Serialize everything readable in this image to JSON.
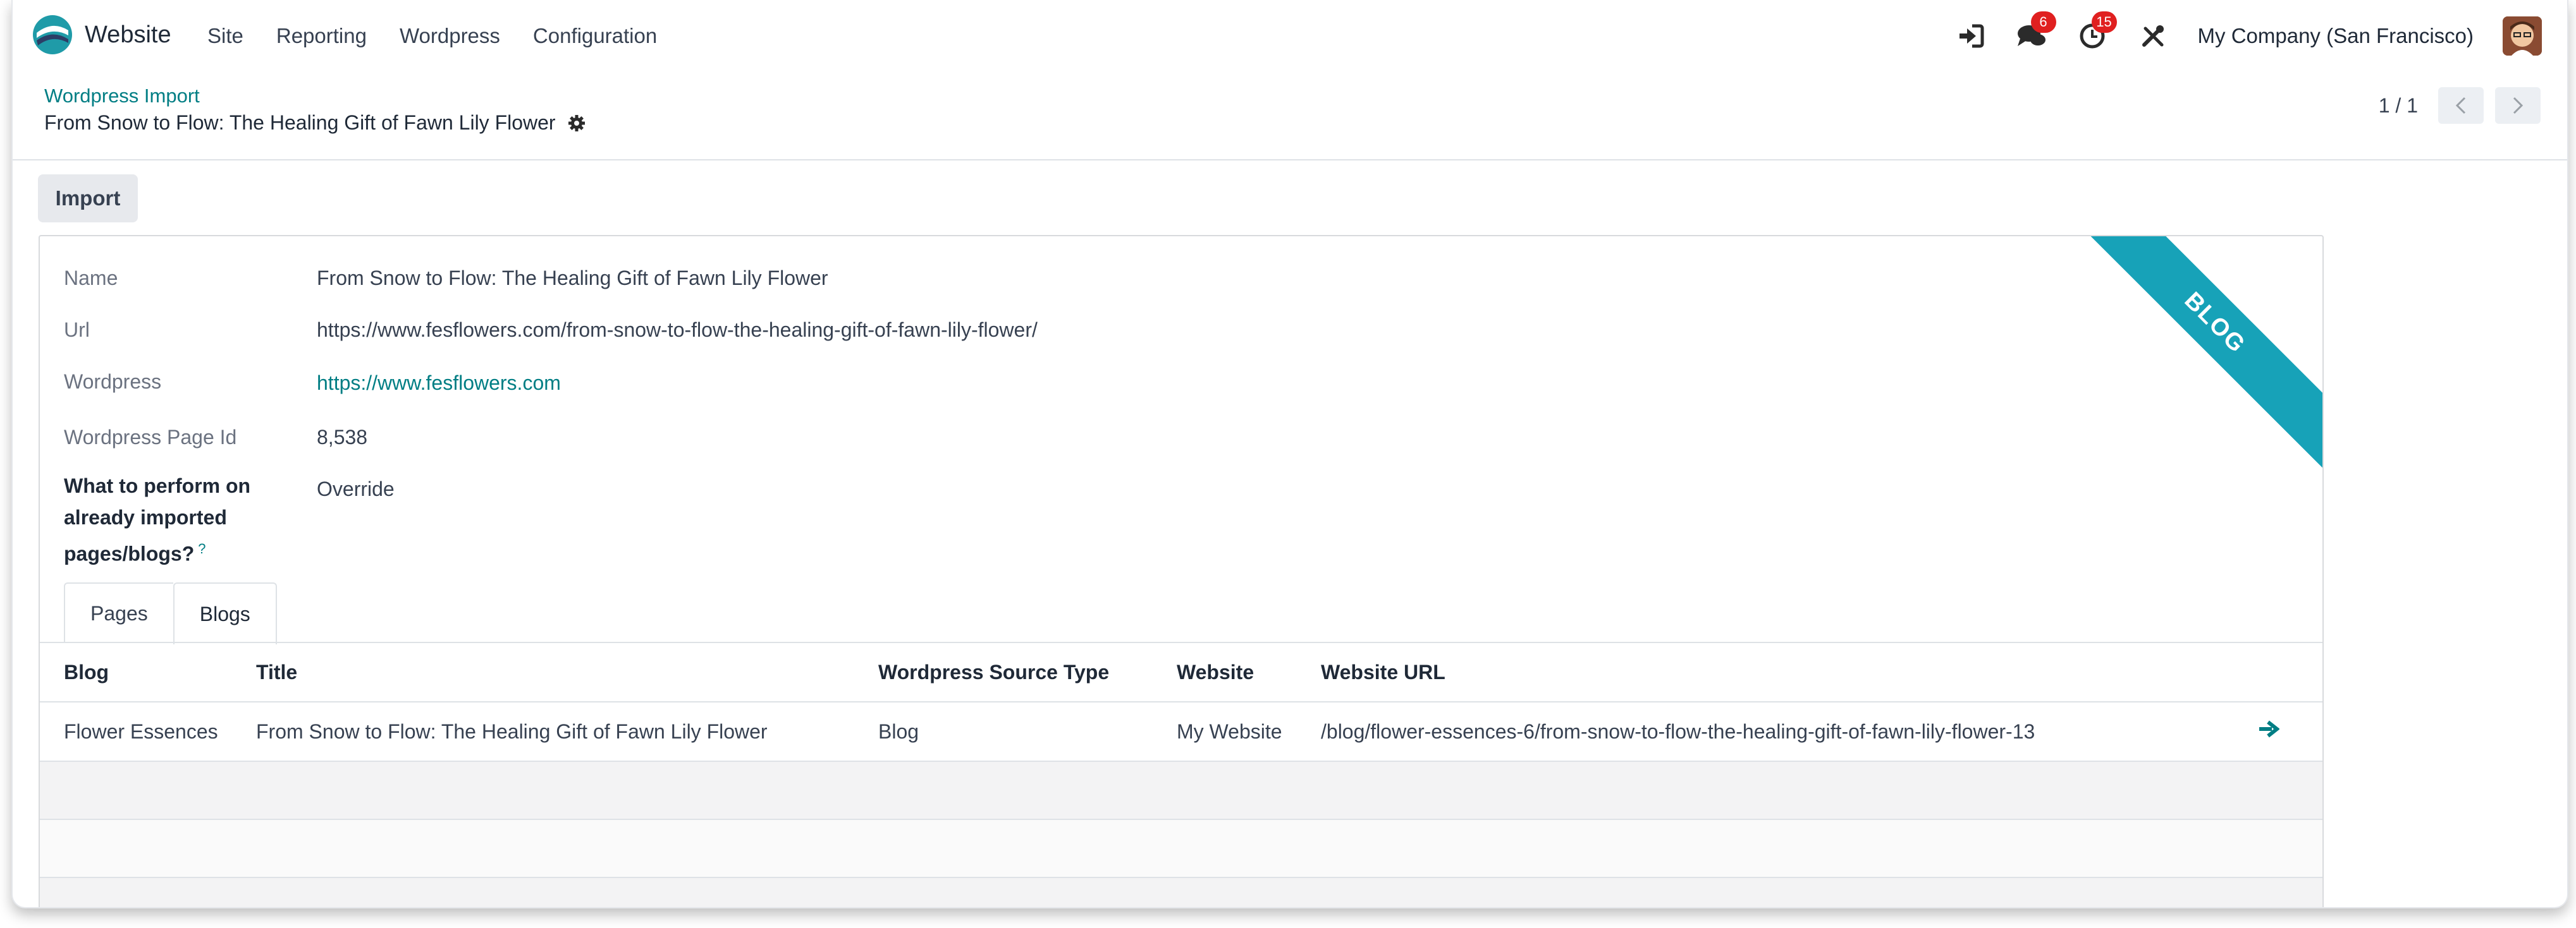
{
  "nav": {
    "app_name": "Website",
    "menu": [
      "Site",
      "Reporting",
      "Wordpress",
      "Configuration"
    ],
    "messages_count": "6",
    "activities_count": "15",
    "company": "My Company (San Francisco)"
  },
  "breadcrumb": {
    "parent": "Wordpress Import",
    "current": "From Snow to Flow: The Healing Gift of Fawn Lily Flower"
  },
  "pager": {
    "value": "1 / 1"
  },
  "buttons": {
    "import": "Import"
  },
  "ribbon": "BLOG",
  "fields": {
    "name_label": "Name",
    "name_value": "From Snow to Flow: The Healing Gift of Fawn Lily Flower",
    "url_label": "Url",
    "url_value": "https://www.fesflowers.com/from-snow-to-flow-the-healing-gift-of-fawn-lily-flower/",
    "wordpress_label": "Wordpress",
    "wordpress_value": "https://www.fesflowers.com",
    "page_id_label": "Wordpress Page Id",
    "page_id_value": "8,538",
    "perform_label_1": "What to perform on",
    "perform_label_2": "already imported",
    "perform_label_3": "pages/blogs?",
    "perform_help": "?",
    "perform_value": "Override"
  },
  "tabs": [
    "Pages",
    "Blogs"
  ],
  "table": {
    "headers": [
      "Blog",
      "Title",
      "Wordpress Source Type",
      "Website",
      "Website URL"
    ],
    "rows": [
      {
        "blog": "Flower Essences",
        "title": "From Snow to Flow: The Healing Gift of Fawn Lily Flower",
        "source_type": "Blog",
        "website": "My Website",
        "url": "/blog/flower-essences-6/from-snow-to-flow-the-healing-gift-of-fawn-lily-flower-13"
      }
    ]
  },
  "colors": {
    "accent": "#017e84",
    "ribbon": "#17a2b8",
    "badge": "#e02020"
  }
}
